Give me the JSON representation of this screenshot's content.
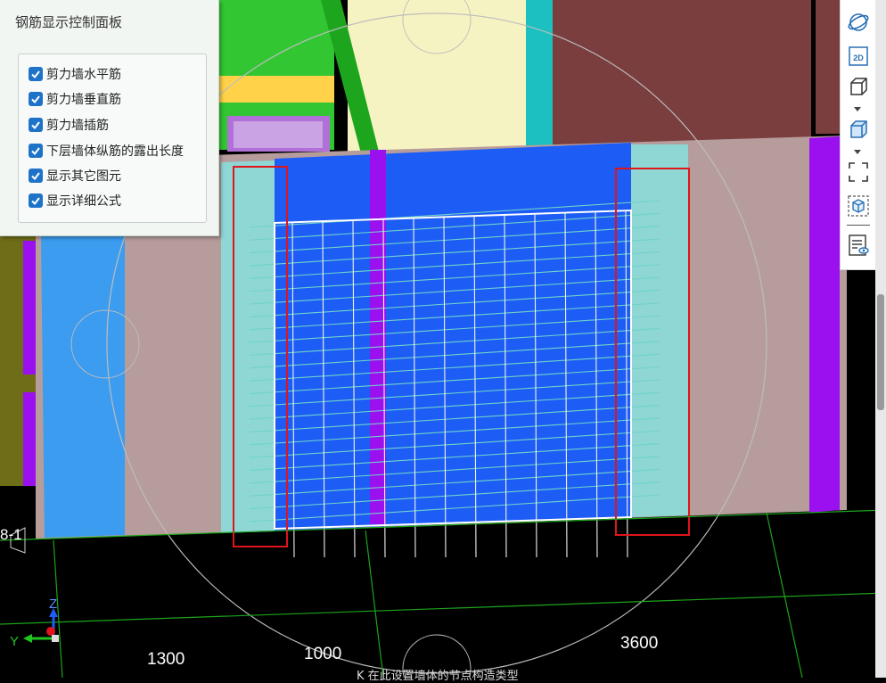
{
  "panel": {
    "title": "钢筋显示控制面板",
    "options": [
      {
        "label": "剪力墙水平筋",
        "checked": true
      },
      {
        "label": "剪力墙垂直筋",
        "checked": true
      },
      {
        "label": "剪力墙插筋",
        "checked": true
      },
      {
        "label": "下层墙体纵筋的露出长度",
        "checked": true
      },
      {
        "label": "显示其它图元",
        "checked": true
      },
      {
        "label": "显示详细公式",
        "checked": true
      }
    ]
  },
  "toolbar": {
    "tools": [
      "orbit-icon",
      "2d-view-icon",
      "3d-box-icon",
      "3d-solid-box-icon",
      "zoom-fit-icon",
      "element-cube-icon",
      "properties-list-icon"
    ],
    "view_2d_label": "2D"
  },
  "viewport": {
    "dimension_labels": [
      "1300",
      "1000",
      "3600"
    ],
    "axis_label": "8-1",
    "axis_y": "Y",
    "axis_z": "Z",
    "status_text": "K 在此设置墙体的节点构造类型"
  },
  "colors": {
    "background": "#000000",
    "wall_blue": "#1d5cf5",
    "wall_cyan": "#8ed7d5",
    "wall_pink": "#b79c9c",
    "purple": "#9a10ee",
    "highlight_red": "#e0141a",
    "green": "#21c421",
    "checkbox": "#1e73c8"
  }
}
